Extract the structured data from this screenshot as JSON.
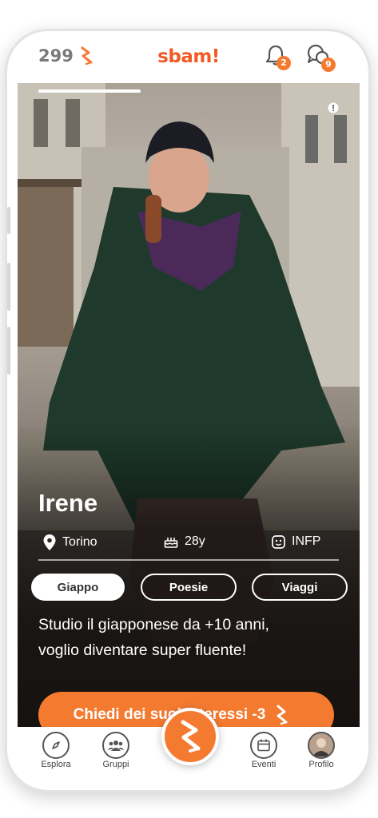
{
  "header": {
    "coins": "299",
    "logo": "sbam!",
    "notifications_count": "2",
    "messages_count": "9"
  },
  "profile": {
    "name": "Irene",
    "city": "Torino",
    "age": "28y",
    "personality": "INFP",
    "interests": [
      "Giappo",
      "Poesie",
      "Viaggi"
    ],
    "bio_line1": "Studio il giapponese da +10 anni,",
    "bio_line2": "voglio diventare super fluente!"
  },
  "cta": {
    "label": "Chiedi dei suoi interessi -3"
  },
  "nav": {
    "explore": "Esplora",
    "groups": "Gruppi",
    "events": "Eventi",
    "profile": "Profilo"
  },
  "colors": {
    "accent": "#f47a30",
    "logo": "#f25a24"
  },
  "icons": [
    "bolt-icon",
    "bell-icon",
    "chat-bubbles-icon",
    "info-icon",
    "location-pin-icon",
    "cake-icon",
    "personality-icon",
    "compass-icon",
    "group-icon",
    "calendar-icon",
    "avatar-icon"
  ]
}
